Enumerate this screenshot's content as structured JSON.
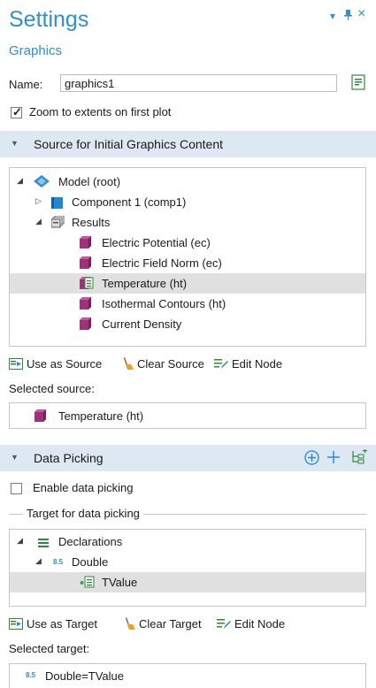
{
  "window": {
    "title": "Settings",
    "subtitle": "Graphics",
    "controls": {
      "dropdown": "▾",
      "pin": "⊥",
      "close": "×"
    }
  },
  "name_field": {
    "label": "Name:",
    "value": "graphics1"
  },
  "zoom_checkbox": {
    "label": "Zoom to extents on first plot",
    "checked": true
  },
  "source_section": {
    "header": "Source for Initial Graphics Content",
    "tree": {
      "root": "Model (root)",
      "component": "Component 1 (comp1)",
      "results": "Results",
      "items": [
        "Electric Potential (ec)",
        "Electric Field Norm (ec)",
        "Temperature (ht)",
        "Isothermal Contours (ht)",
        "Current Density"
      ],
      "selected_index": 2
    },
    "toolbar": {
      "use": "Use as Source",
      "clear": "Clear Source",
      "edit": "Edit Node"
    },
    "selected_label": "Selected source:",
    "selected_value": "Temperature (ht)"
  },
  "picking_section": {
    "header": "Data Picking",
    "header_icons": [
      "add-circle-icon",
      "plus-icon",
      "tree-add-icon"
    ],
    "enable_label": "Enable data picking",
    "enable_checked": false,
    "group_label": "Target for data picking",
    "tree": {
      "declarations": "Declarations",
      "double_badge": "8.5",
      "double": "Double",
      "tvalue": "TValue"
    },
    "toolbar": {
      "use": "Use as Target",
      "clear": "Clear Target",
      "edit": "Edit Node"
    },
    "selected_label": "Selected target:",
    "selected_badge": "8.5",
    "selected_value": "Double=TValue"
  },
  "colors": {
    "accent": "#2f8fd0",
    "section_bg": "#dde8f3",
    "cube": "#a0307a",
    "selection": "#e0e0e0"
  }
}
